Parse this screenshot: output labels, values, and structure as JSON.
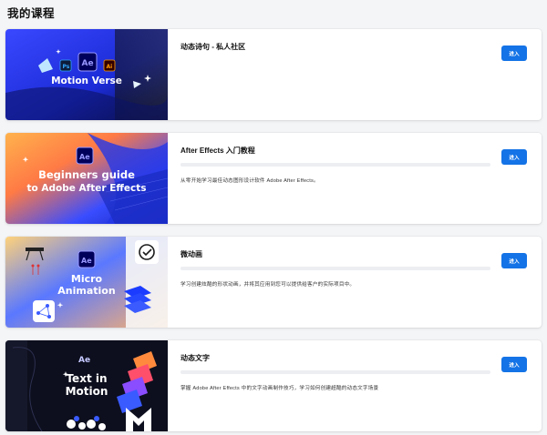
{
  "page": {
    "title": "我的课程"
  },
  "courses": [
    {
      "title": "动态诗句 - 私人社区",
      "description": "",
      "show_progress": false,
      "progress": 0,
      "button_label": "进入",
      "thumbnail": {
        "art_text": [
          "Motion Verse"
        ],
        "app_badges": [
          "Ps",
          "Ae",
          "Ai"
        ],
        "accent": "#2a3bff"
      }
    },
    {
      "title": "After Effects 入门教程",
      "description": "从零开始学习最佳动态图形设计软件 Adobe After Effects。",
      "show_progress": true,
      "progress": 0,
      "button_label": "进入",
      "thumbnail": {
        "art_text": [
          "Beginners guide",
          "to Adobe After Effects"
        ],
        "app_badges": [
          "Ae"
        ],
        "accent": "#2f4bff"
      }
    },
    {
      "title": "微动画",
      "description": "学习创建炫酷的形状动画，并将其应用到您可以提供给客户的实际项目中。",
      "show_progress": true,
      "progress": 0,
      "button_label": "进入",
      "thumbnail": {
        "art_text": [
          "Micro",
          "Animation"
        ],
        "app_badges": [
          "Ae"
        ],
        "accent": "#3d5bff"
      }
    },
    {
      "title": "动态文字",
      "description": "掌握 Adobe After Effects 中的文字动画制作技巧，学习如何创建超酷的动态文字场景",
      "show_progress": true,
      "progress": 0,
      "button_label": "进入",
      "thumbnail": {
        "art_text": [
          "Text in",
          "Motion"
        ],
        "app_badges": [
          "Ae"
        ],
        "accent": "#1a1f4a"
      }
    }
  ],
  "colors": {
    "primary_button": "#1473e6",
    "progress_track": "#eceef1",
    "page_bg": "#f4f5f7"
  }
}
